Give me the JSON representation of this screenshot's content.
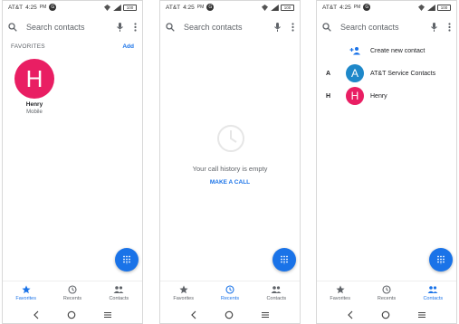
{
  "status": {
    "carrier": "AT&T",
    "time": "4:25",
    "ampm": "PM",
    "badge": "G",
    "battery": "100"
  },
  "search": {
    "placeholder": "Search contacts"
  },
  "favorites_screen": {
    "section_label": "FAVORITES",
    "add_label": "Add",
    "favorite": {
      "initial": "H",
      "name": "Henry",
      "subtitle": "Mobile"
    }
  },
  "recents_screen": {
    "empty_message": "Your call history is empty",
    "make_call_label": "MAKE A CALL"
  },
  "contacts_screen": {
    "create_label": "Create new contact",
    "contacts": [
      {
        "letter": "A",
        "initial": "A",
        "name": "AT&T Service Contacts"
      },
      {
        "letter": "H",
        "initial": "H",
        "name": "Henry"
      }
    ]
  },
  "tabs": [
    {
      "label": "Favorites",
      "icon": "star-icon"
    },
    {
      "label": "Recents",
      "icon": "clock-icon"
    },
    {
      "label": "Contacts",
      "icon": "people-icon"
    }
  ],
  "colors": {
    "accent": "#1a73e8",
    "pink_avatar": "#e91e63",
    "blue_avatar": "#1e88c9",
    "inactive": "#5f6368"
  }
}
